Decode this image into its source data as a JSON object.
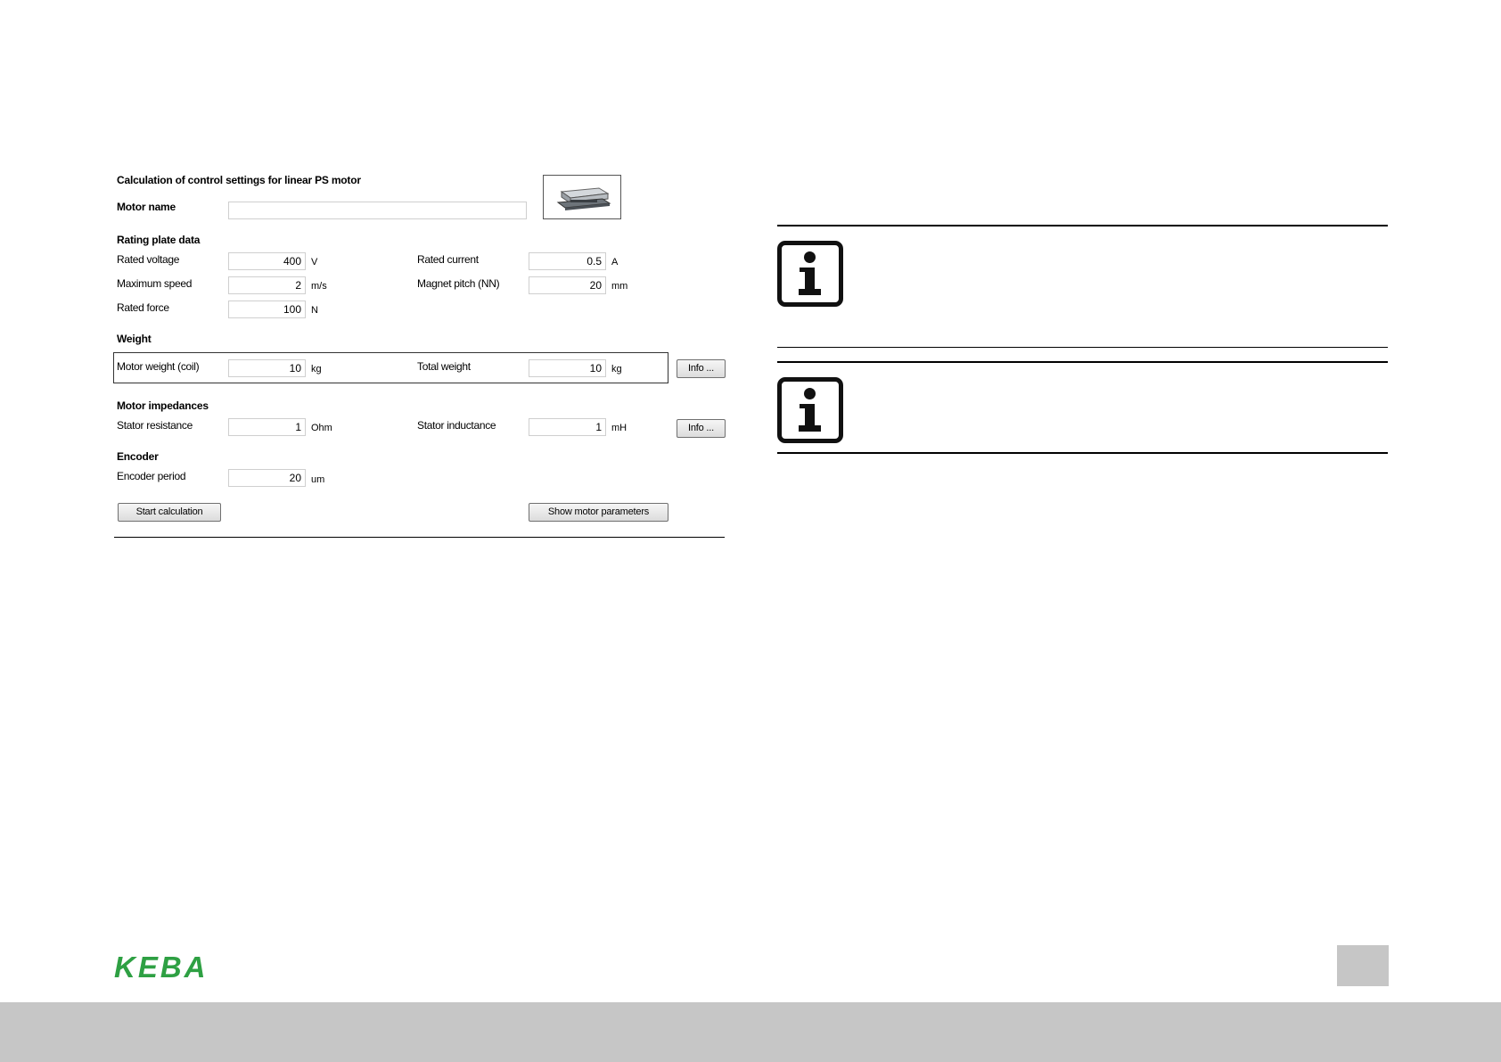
{
  "dialog": {
    "title": "Calculation of control settings for linear PS motor",
    "motor_name_label": "Motor name",
    "motor_name_value": "",
    "rating": {
      "heading": "Rating plate data",
      "rated_voltage": {
        "label": "Rated voltage",
        "value": "400",
        "unit": "V"
      },
      "maximum_speed": {
        "label": "Maximum speed",
        "value": "2",
        "unit": "m/s"
      },
      "rated_force": {
        "label": "Rated force",
        "value": "100",
        "unit": "N"
      },
      "rated_current": {
        "label": "Rated current",
        "value": "0.5",
        "unit": "A"
      },
      "magnet_pitch": {
        "label": "Magnet pitch (NN)",
        "value": "20",
        "unit": "mm"
      }
    },
    "weight": {
      "heading": "Weight",
      "motor_weight": {
        "label": "Motor weight (coil)",
        "value": "10",
        "unit": "kg"
      },
      "total_weight": {
        "label": "Total weight",
        "value": "10",
        "unit": "kg"
      },
      "info_button": "Info ..."
    },
    "impedances": {
      "heading": "Motor impedances",
      "stator_resistance": {
        "label": "Stator resistance",
        "value": "1",
        "unit": "Ohm"
      },
      "stator_inductance": {
        "label": "Stator inductance",
        "value": "1",
        "unit": "mH"
      },
      "info_button": "Info ..."
    },
    "encoder": {
      "heading": "Encoder",
      "encoder_period": {
        "label": "Encoder period",
        "value": "20",
        "unit": "um"
      }
    },
    "buttons": {
      "start": "Start calculation",
      "show_params": "Show motor parameters"
    }
  },
  "icons": {
    "motor_image": "linear-motor-icon",
    "info": "info-icon",
    "logo": "keba-logo"
  },
  "footer": {
    "logo_text": "KEBA",
    "logo_color": "#2ea043"
  }
}
